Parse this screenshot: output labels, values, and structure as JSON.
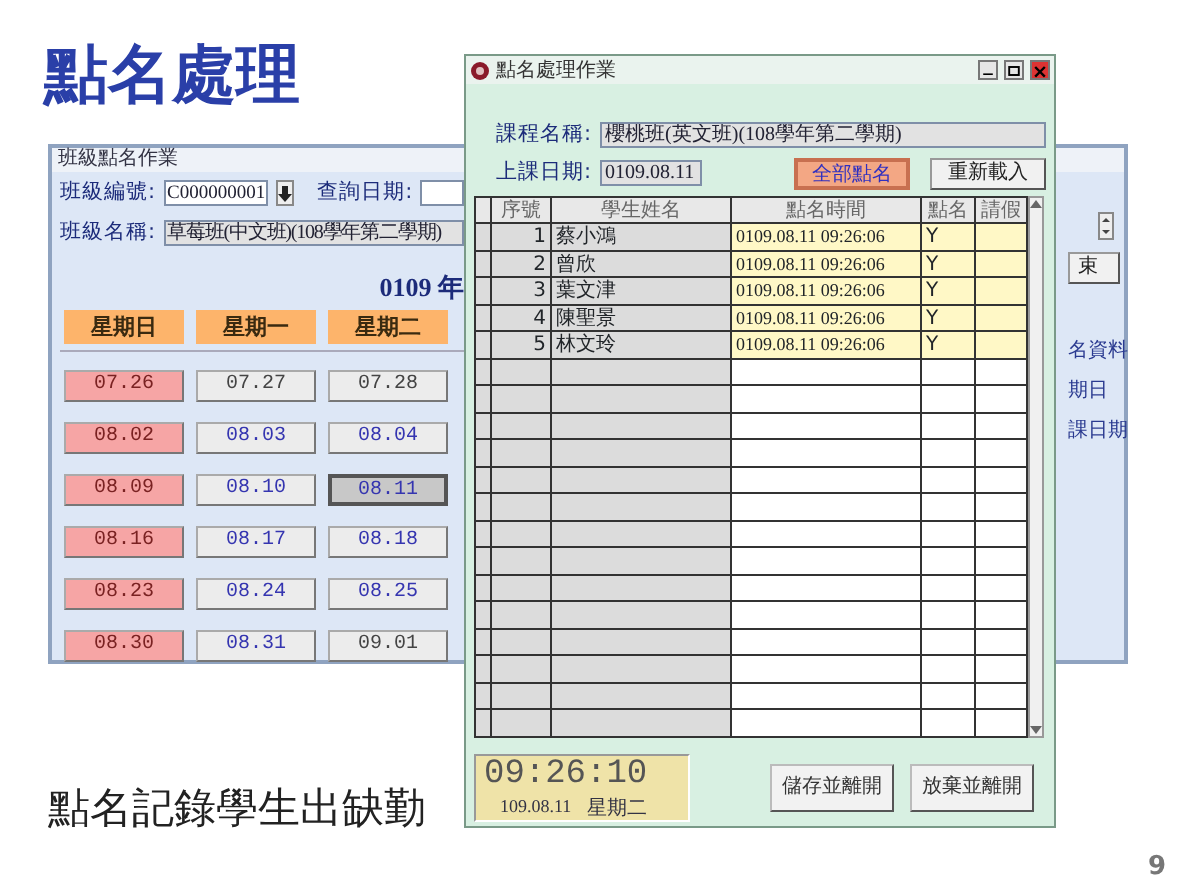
{
  "slide": {
    "title": "點名處理",
    "caption": "點名記錄學生出缺勤",
    "page_number": "9"
  },
  "class_window": {
    "title": "班級點名作業",
    "class_no_label": "班級編號:",
    "class_no_value": "C000000001",
    "query_date_label": "查詢日期:",
    "class_name_label": "班級名稱:",
    "class_name_value": "草莓班(中文班)(108學年第二學期)",
    "year_label": "0109 年",
    "weekday_headers": [
      "星期日",
      "星期一",
      "星期二"
    ],
    "date_rows": [
      [
        {
          "label": "07.26",
          "kind": "sunday",
          "selected": false
        },
        {
          "label": "07.27",
          "kind": "plain",
          "selected": false
        },
        {
          "label": "07.28",
          "kind": "plain",
          "selected": false
        }
      ],
      [
        {
          "label": "08.02",
          "kind": "sunday",
          "selected": false
        },
        {
          "label": "08.03",
          "kind": "lesson",
          "selected": false
        },
        {
          "label": "08.04",
          "kind": "lesson",
          "selected": false
        }
      ],
      [
        {
          "label": "08.09",
          "kind": "sunday",
          "selected": false
        },
        {
          "label": "08.10",
          "kind": "lesson",
          "selected": false
        },
        {
          "label": "08.11",
          "kind": "lesson",
          "selected": true
        }
      ],
      [
        {
          "label": "08.16",
          "kind": "sunday",
          "selected": false
        },
        {
          "label": "08.17",
          "kind": "lesson",
          "selected": false
        },
        {
          "label": "08.18",
          "kind": "lesson",
          "selected": false
        }
      ],
      [
        {
          "label": "08.23",
          "kind": "sunday",
          "selected": false
        },
        {
          "label": "08.24",
          "kind": "lesson",
          "selected": false
        },
        {
          "label": "08.25",
          "kind": "lesson",
          "selected": false
        }
      ],
      [
        {
          "label": "08.30",
          "kind": "sunday",
          "selected": false
        },
        {
          "label": "08.31",
          "kind": "lesson",
          "selected": false
        },
        {
          "label": "09.01",
          "kind": "plain",
          "selected": false
        }
      ]
    ],
    "side_button": "束",
    "side_texts": [
      "名資料",
      "期日",
      "課日期"
    ]
  },
  "roll_window": {
    "title": "點名處理作業",
    "course_label": "課程名稱:",
    "course_value": "櫻桃班(英文班)(108學年第二學期)",
    "date_label": "上課日期:",
    "date_value": "0109.08.11",
    "buttons": [
      {
        "label": "全部點名",
        "selected": true
      },
      {
        "label": "重新載入",
        "selected": false
      }
    ],
    "columns": [
      "序號",
      "學生姓名",
      "點名時間",
      "點名",
      "請假"
    ],
    "rows": [
      {
        "no": "1",
        "name": "蔡小鴻",
        "time": "0109.08.11 09:26:06",
        "present": "Y"
      },
      {
        "no": "2",
        "name": "曾欣",
        "time": "0109.08.11 09:26:06",
        "present": "Y"
      },
      {
        "no": "3",
        "name": "葉文津",
        "time": "0109.08.11 09:26:06",
        "present": "Y"
      },
      {
        "no": "4",
        "name": "陳聖景",
        "time": "0109.08.11 09:26:06",
        "present": "Y"
      },
      {
        "no": "5",
        "name": "林文玲",
        "time": "0109.08.11 09:26:06",
        "present": "Y"
      }
    ],
    "clock_time": "09:26:10",
    "clock_date": "109.08.11",
    "clock_weekday": "星期二",
    "footer_buttons": [
      "儲存並離開",
      "放棄並離開"
    ]
  }
}
